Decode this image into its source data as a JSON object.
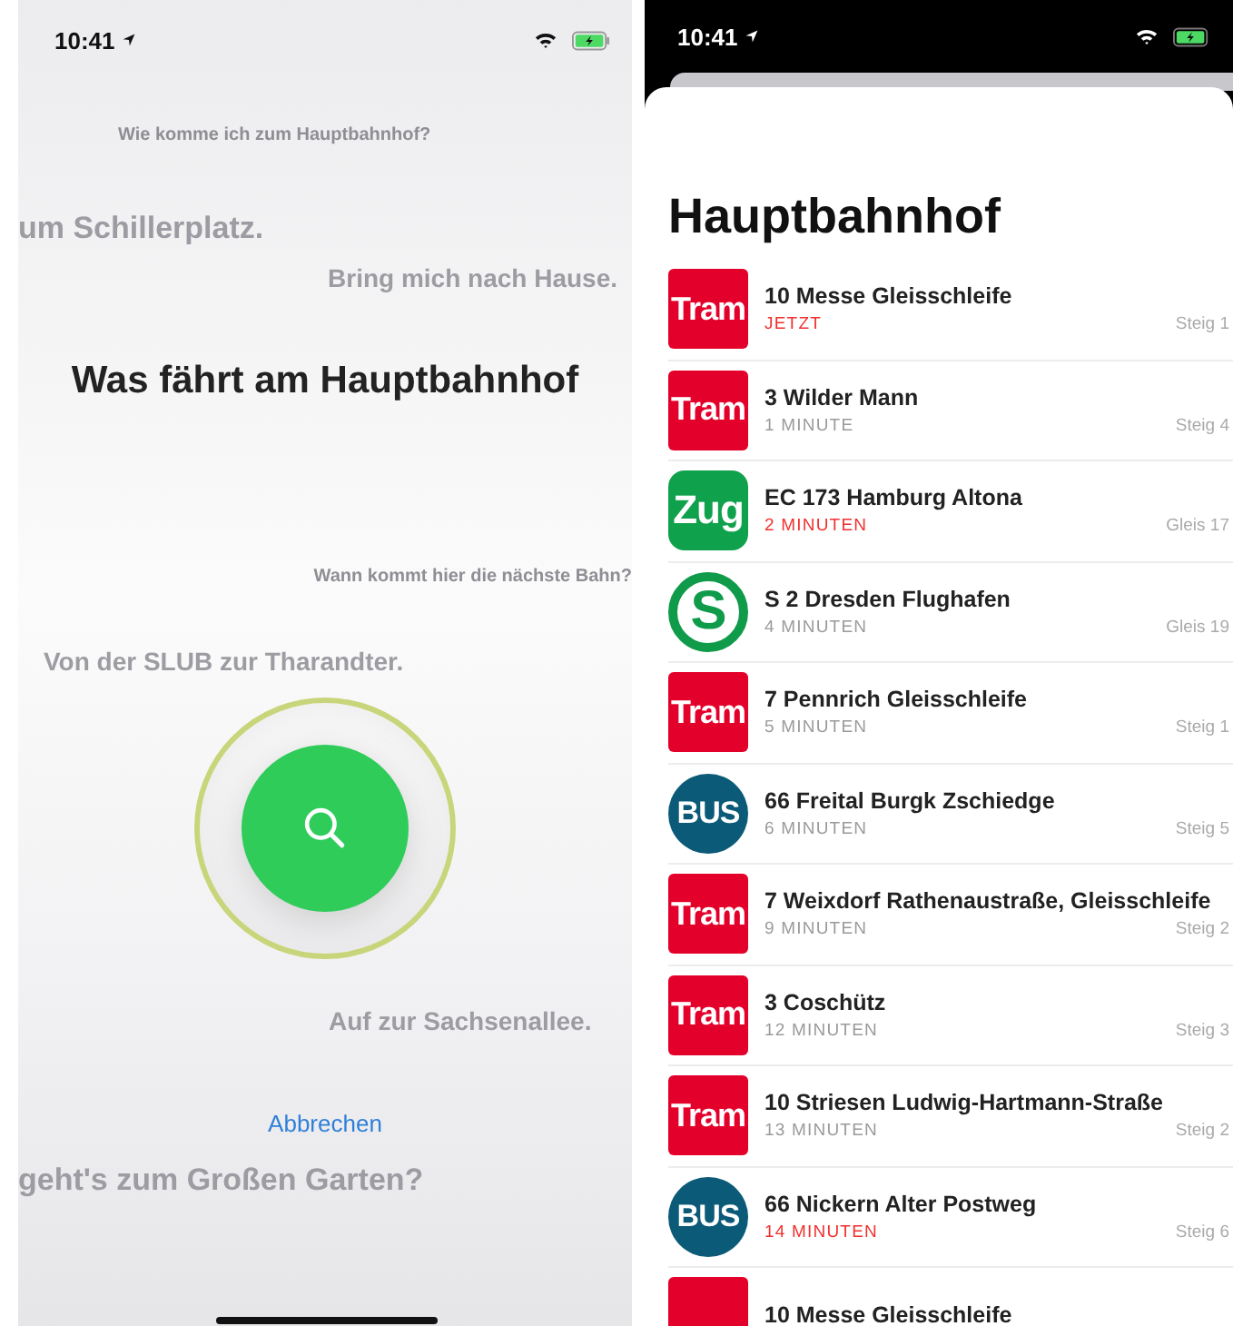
{
  "left_screen": {
    "status_bar": {
      "time": "10:41"
    },
    "suggestions": [
      "Wie komme ich zum Hauptbahnhof?",
      "um Schillerplatz.",
      "Bring mich nach Hause.",
      "Wann kommt hier die nächste Bahn?",
      "Von der SLUB zur Tharandter.",
      "Auf zur Sachsenallee.",
      "geht's zum Großen Garten?"
    ],
    "prompt": "Was fährt am Hauptbahnhof",
    "cancel_button": "Abbrechen"
  },
  "right_screen": {
    "status_bar": {
      "time": "10:41"
    },
    "title": "Hauptbahnhof",
    "departures": [
      {
        "kind": "tram",
        "badge": "Tram",
        "line": "10 Messe Gleisschleife",
        "time": "JETZT",
        "urgent": true,
        "platform": "Steig 1"
      },
      {
        "kind": "tram",
        "badge": "Tram",
        "line": "3 Wilder Mann",
        "time": "1 MINUTE",
        "urgent": false,
        "platform": "Steig 4"
      },
      {
        "kind": "train",
        "badge": "Zug",
        "line": "EC 173 Hamburg Altona",
        "time": "2 MINUTEN",
        "urgent": true,
        "platform": "Gleis 17"
      },
      {
        "kind": "sbahn",
        "badge": "S",
        "line": "S 2 Dresden Flughafen",
        "time": "4 MINUTEN",
        "urgent": false,
        "platform": "Gleis 19"
      },
      {
        "kind": "tram",
        "badge": "Tram",
        "line": "7 Pennrich Gleisschleife",
        "time": "5 MINUTEN",
        "urgent": false,
        "platform": "Steig 1"
      },
      {
        "kind": "bus",
        "badge": "BUS",
        "line": "66 Freital Burgk Zschiedge",
        "time": "6 MINUTEN",
        "urgent": false,
        "platform": "Steig 5"
      },
      {
        "kind": "tram",
        "badge": "Tram",
        "line": "7 Weixdorf Rathenaustraße, Gleisschleife",
        "time": "9 MINUTEN",
        "urgent": false,
        "platform": "Steig 2"
      },
      {
        "kind": "tram",
        "badge": "Tram",
        "line": "3 Coschütz",
        "time": "12 MINUTEN",
        "urgent": false,
        "platform": "Steig 3"
      },
      {
        "kind": "tram",
        "badge": "Tram",
        "line": "10 Striesen Ludwig-Hartmann-Straße",
        "time": "13 MINUTEN",
        "urgent": false,
        "platform": "Steig 2"
      },
      {
        "kind": "bus",
        "badge": "BUS",
        "line": "66 Nickern Alter Postweg",
        "time": "14 MINUTEN",
        "urgent": true,
        "platform": "Steig 6"
      },
      {
        "kind": "tram",
        "line": "10 Messe Gleisschleife"
      }
    ]
  }
}
